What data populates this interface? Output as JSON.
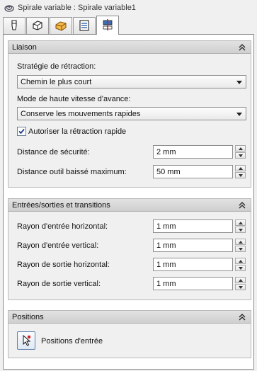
{
  "window": {
    "title": "Spirale variable : Spirale variable1",
    "title_icon": "spiral-icon"
  },
  "tabs": [
    {
      "icon": "tool-icon",
      "active": false
    },
    {
      "icon": "geometry-icon",
      "active": false
    },
    {
      "icon": "stock-icon",
      "active": false
    },
    {
      "icon": "parameters-icon",
      "active": false
    },
    {
      "icon": "linking-icon",
      "active": true
    }
  ],
  "liaison": {
    "header": "Liaison",
    "retraction_label": "Stratégie de rétraction:",
    "retraction_value": "Chemin le plus court",
    "feed_mode_label": "Mode de haute vitesse d'avance:",
    "feed_mode_value": "Conserve les mouvements rapides",
    "rapid_retract_label": "Autoriser la rétraction rapide",
    "rapid_retract_checked": true,
    "safe_distance_label": "Distance de sécurité:",
    "safe_distance_value": "2 mm",
    "max_drop_label": "Distance outil baissé maximum:",
    "max_drop_value": "50 mm"
  },
  "transitions": {
    "header": "Entrées/sorties et transitions",
    "entry_horizontal_label": "Rayon d'entrée horizontal:",
    "entry_horizontal_value": "1 mm",
    "entry_vertical_label": "Rayon d'entrée vertical:",
    "entry_vertical_value": "1 mm",
    "exit_horizontal_label": "Rayon de sortie horizontal:",
    "exit_horizontal_value": "1 mm",
    "exit_vertical_label": "Rayon de sortie vertical:",
    "exit_vertical_value": "1 mm"
  },
  "positions": {
    "header": "Positions",
    "entry_positions_label": "Positions d'entrée"
  },
  "colors": {
    "header_bg": "#d8d8d8",
    "panel_bg": "#f0f0f0",
    "accent_blue": "#3c6eb4",
    "accent_red": "#d62020"
  }
}
